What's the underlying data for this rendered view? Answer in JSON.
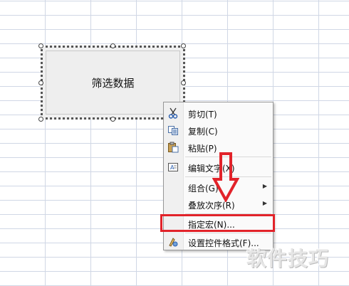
{
  "form_button": {
    "label": "筛选数据"
  },
  "context_menu": {
    "items": [
      {
        "label": "剪切(T)",
        "icon": "scissors-icon"
      },
      {
        "label": "复制(C)",
        "icon": "copy-icon"
      },
      {
        "label": "粘贴(P)",
        "icon": "paste-icon"
      },
      {
        "label": "编辑文字(X)",
        "icon": "text-box-icon"
      },
      {
        "label": "组合(G)",
        "submenu": true
      },
      {
        "label": "叠放次序(R)",
        "submenu": true
      },
      {
        "label": "指定宏(N)..."
      },
      {
        "label": "设置控件格式(F)...",
        "icon": "format-control-icon"
      }
    ]
  },
  "annotation": {
    "color": "#e2232a"
  },
  "watermark": {
    "text": "软件技巧"
  }
}
